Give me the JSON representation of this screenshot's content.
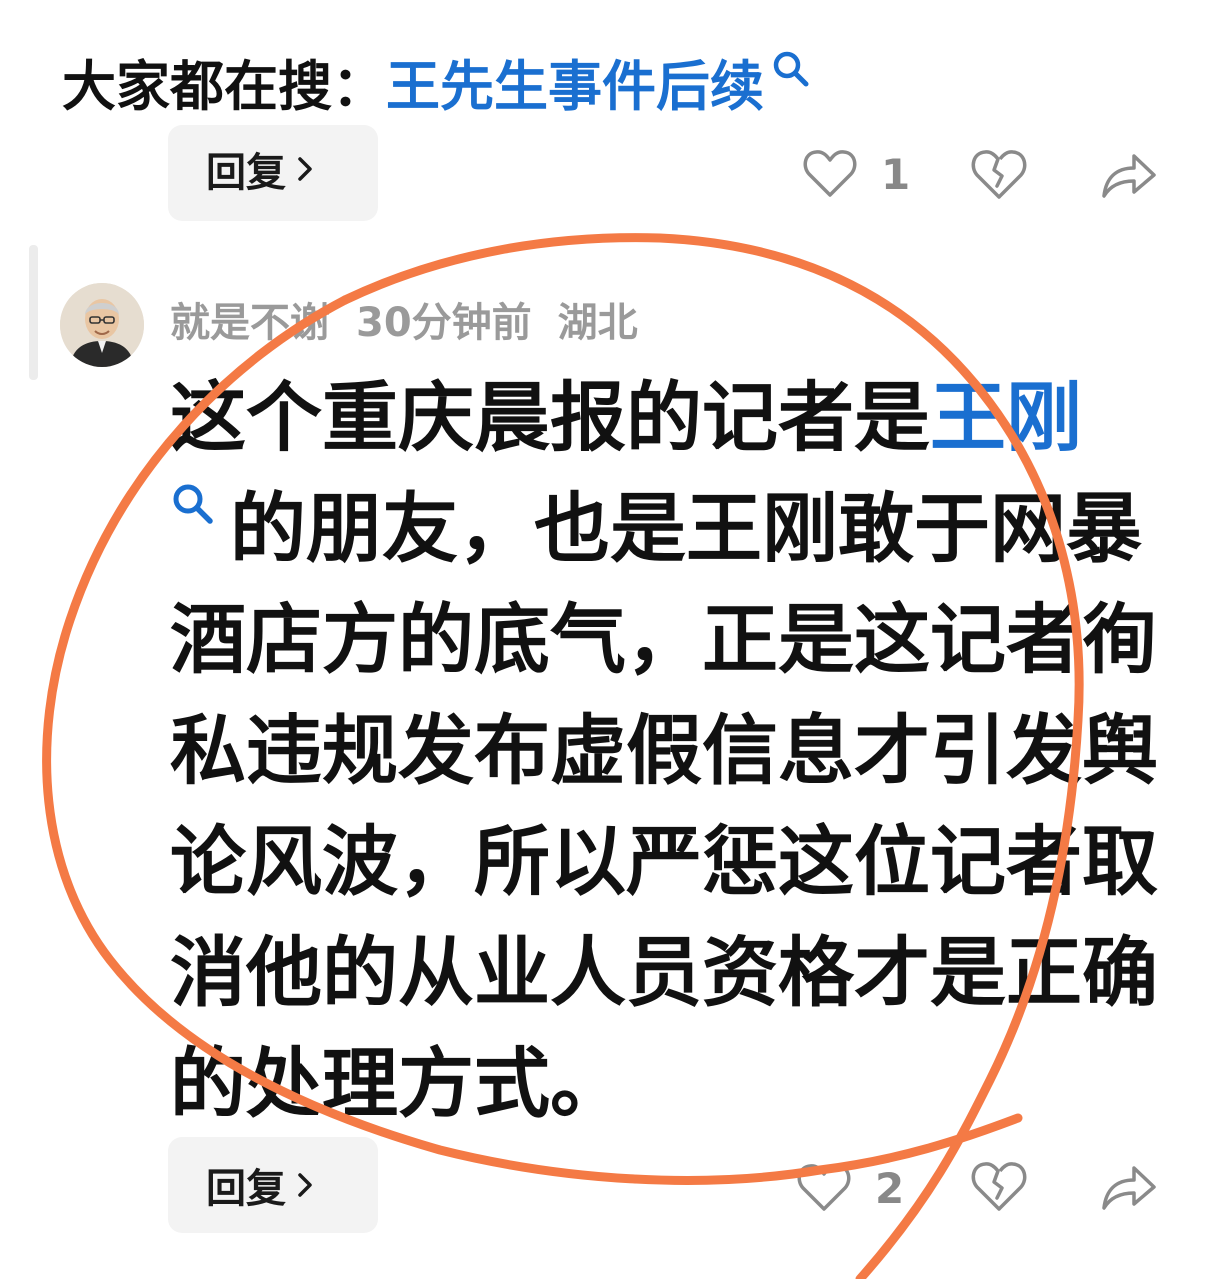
{
  "search_banner": {
    "prefix": "大家都在搜：",
    "term": "王先生事件后续",
    "icon": "search-icon"
  },
  "previous_comment": {
    "reply_label": "回复",
    "like_count": "1"
  },
  "comment": {
    "username": "就是不谢",
    "time": "30分钟前",
    "location": "湖北",
    "text_before_mention": "这个重庆晨报的记者是",
    "mention": "王刚",
    "text_after_mention": "的朋友，也是王刚敢于网暴酒店方的底气，正是这记者徇私违规发布虚假信息才引发舆论风波，所以严惩这位记者取消他的从业人员资格才是正确的处理方式。",
    "reply_label": "回复",
    "like_count": "2"
  },
  "colors": {
    "link_blue": "#1a6fd0",
    "annotation_orange": "#f47a45",
    "meta_gray": "#9a9a9a"
  }
}
